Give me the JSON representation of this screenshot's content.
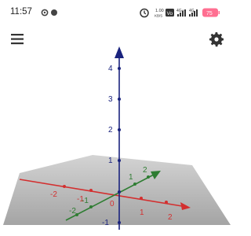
{
  "status_bar": {
    "time": "11:57",
    "net_speed_value": "1.00",
    "net_speed_unit": "KB/S",
    "volte_badge": "Vo",
    "lte_label": "4G+",
    "signal_label": "4G",
    "battery_level": "75"
  },
  "app_bar": {
    "menu_icon": "hamburger-menu-icon",
    "settings_icon": "gear-icon"
  },
  "graph_3d": {
    "z_axis_labels": [
      "4",
      "3",
      "2",
      "1",
      "-1"
    ],
    "x_axis_labels": [
      "-2",
      "-1",
      "1",
      "2"
    ],
    "y_axis_labels": [
      "-2",
      "-1",
      "1",
      "2"
    ],
    "origin_label": "0",
    "colors": {
      "x_axis": "#d32f2f",
      "y_axis": "#2e7d32",
      "z_axis": "#1a237e",
      "plane": "#a9a9a9"
    }
  }
}
